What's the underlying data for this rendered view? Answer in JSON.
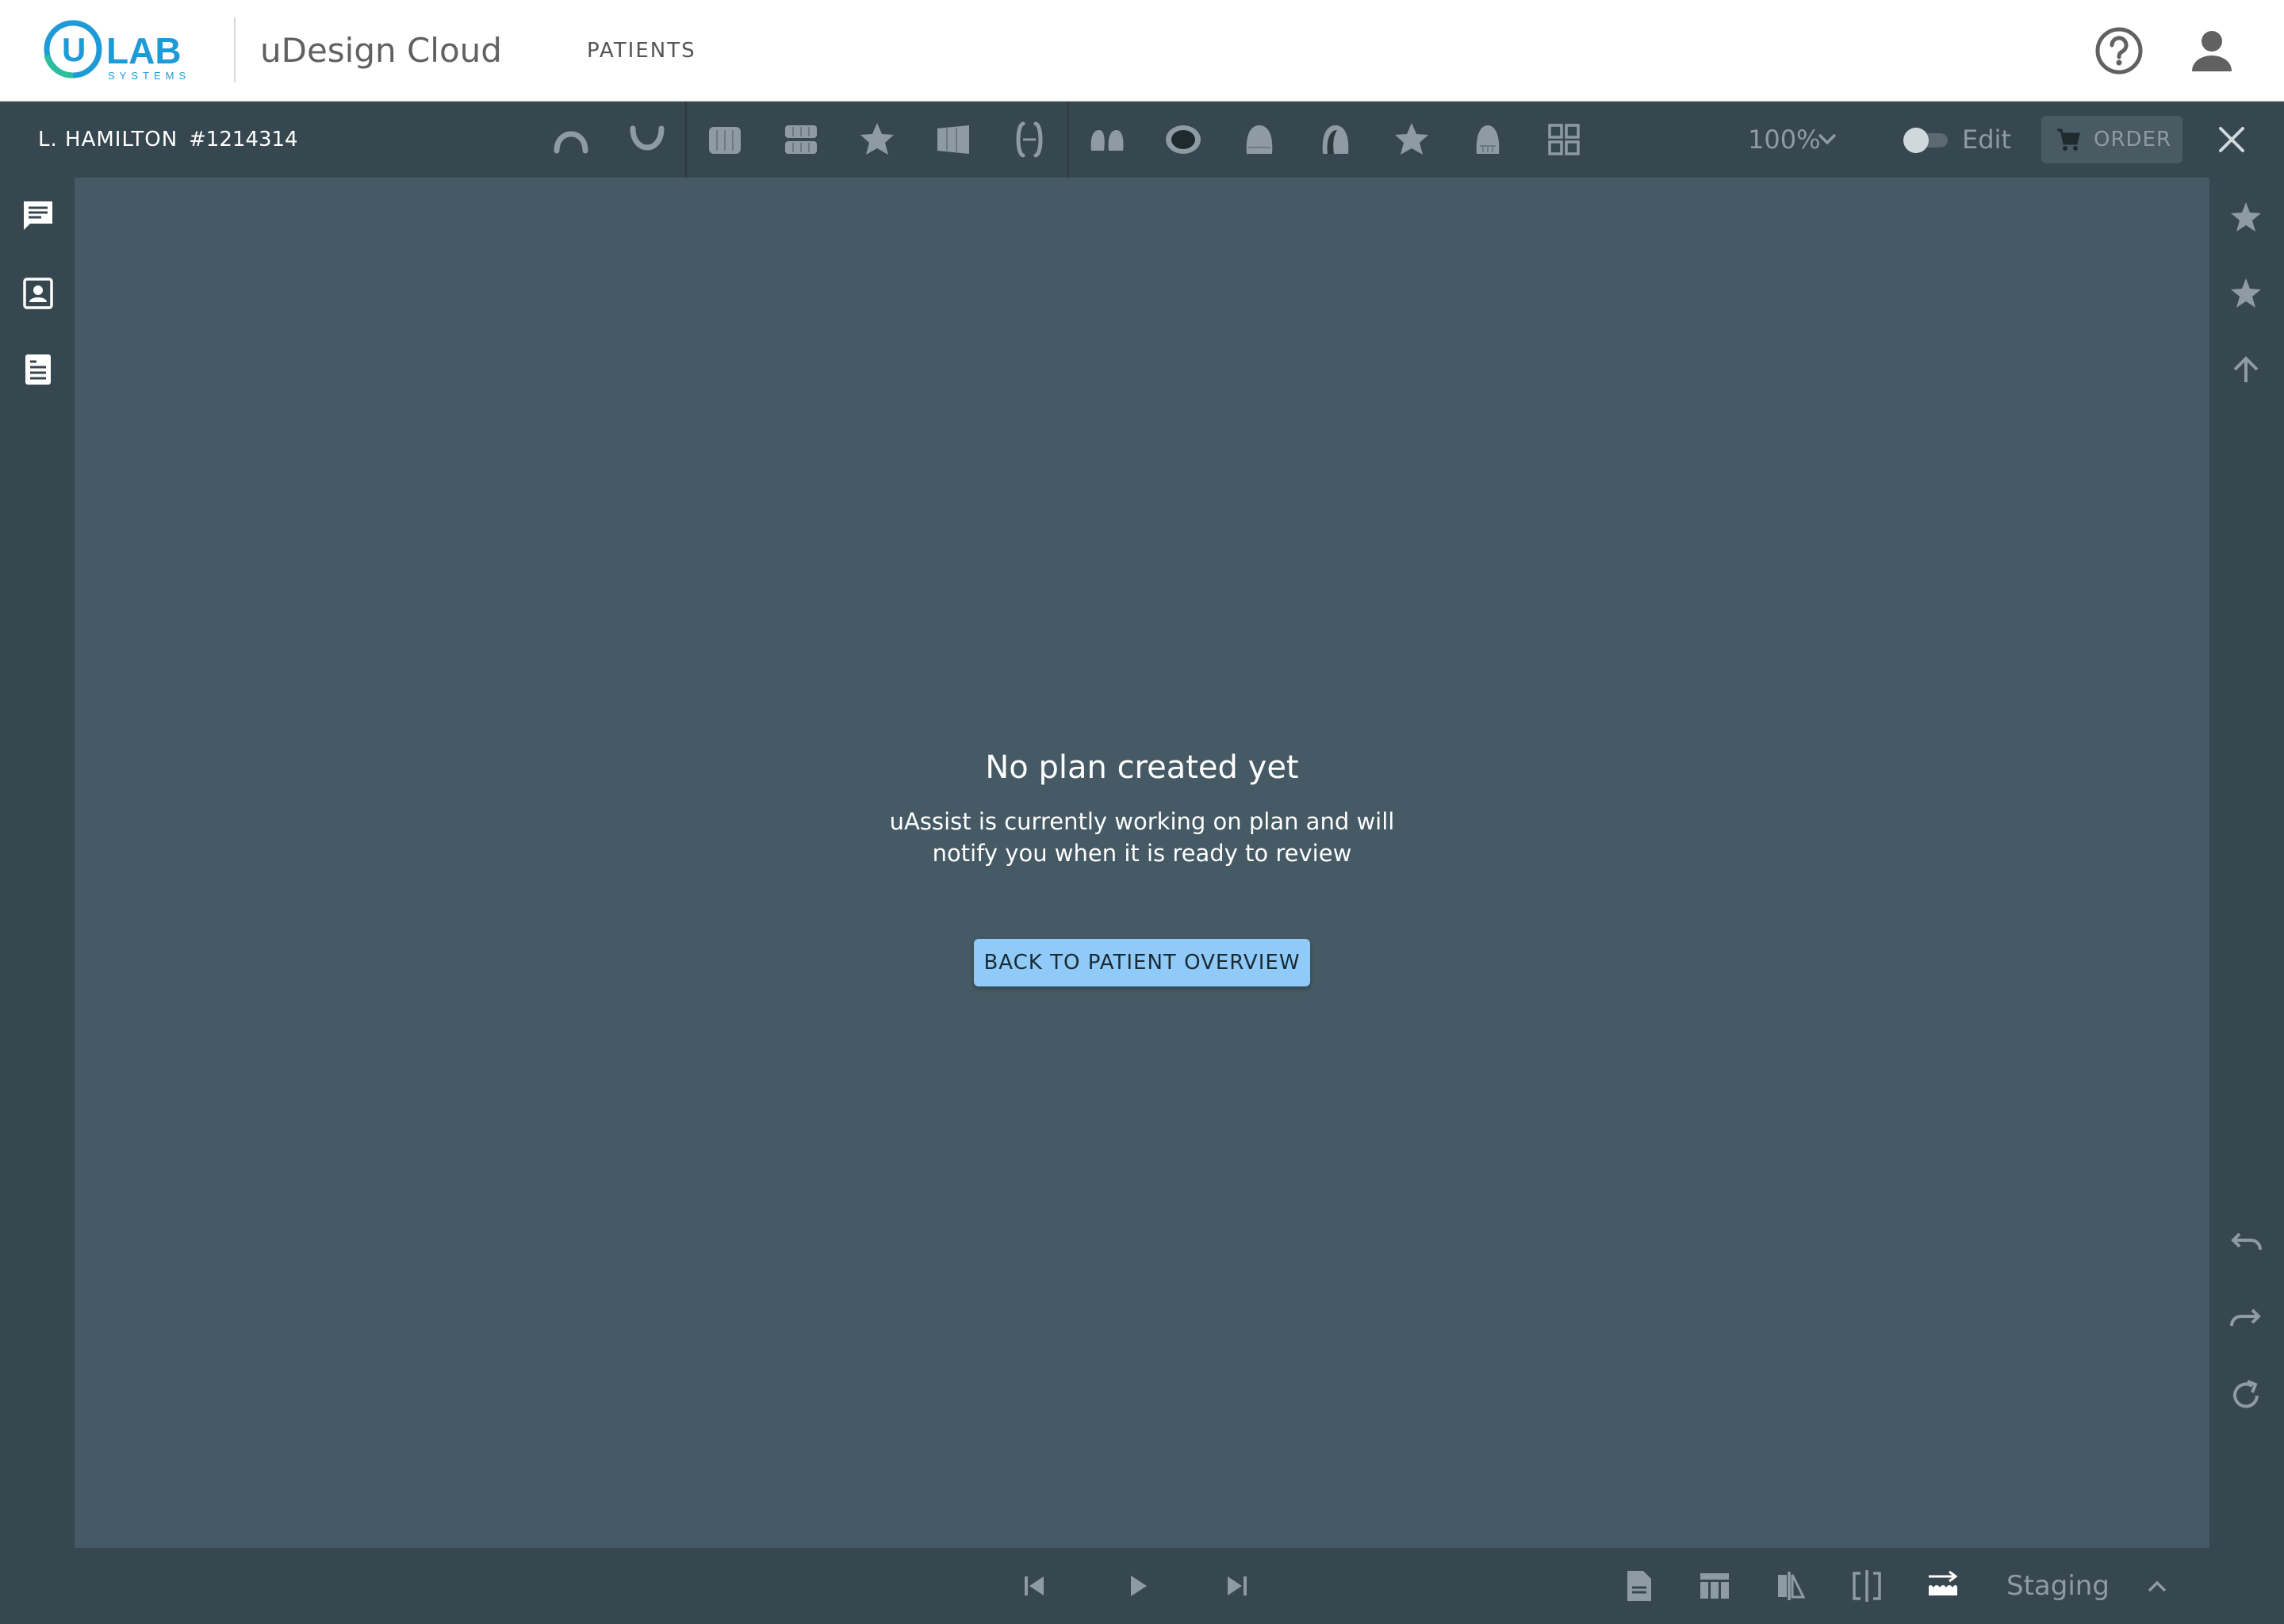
{
  "app": {
    "logo_text": "ULAB",
    "logo_subtext": "SYSTEMS",
    "brand": "uDesign Cloud",
    "nav": {
      "patients": "PATIENTS"
    }
  },
  "toolbar": {
    "patient_name": "L. HAMILTON",
    "patient_id": "#1214314",
    "zoom": "100%",
    "edit_label": "Edit",
    "edit_enabled": false,
    "order_label": "ORDER"
  },
  "canvas": {
    "title": "No plan created yet",
    "message_line1": "uAssist is currently working on plan and will",
    "message_line2": "notify you when it is ready to review",
    "button_label": "BACK TO PATIENT OVERVIEW"
  },
  "bottom": {
    "staging_label": "Staging"
  },
  "colors": {
    "toolbar_bg": "#37474f",
    "canvas_bg": "#455a64",
    "accent_button": "#90caf9",
    "logo_blue": "#1e9ad6",
    "icon_muted": "#8e9ba2"
  },
  "icons": {
    "toolbar": [
      "upper-arch-icon",
      "lower-arch-icon",
      "teeth-front-icon",
      "teeth-both-icon",
      "favorite-star-icon",
      "teeth-side-icon",
      "teeth-split-icon",
      "tooth-pair-icon",
      "tooth-dark-icon",
      "tooth-crown-icon",
      "tooth-shaded-icon",
      "favorite-star-icon-2",
      "tooth-occlusal-icon",
      "grid-view-icon"
    ],
    "left_rail": [
      "chat-icon",
      "patient-card-icon",
      "records-icon"
    ],
    "right_rail": [
      "star-icon",
      "star-icon-2",
      "arrow-up-icon",
      "undo-icon",
      "redo-icon",
      "refresh-icon"
    ],
    "bottom": [
      "skip-previous-icon",
      "play-icon",
      "skip-next-icon",
      "report-icon",
      "table-layout-icon",
      "compare-icon",
      "split-view-icon",
      "staging-teeth-icon"
    ]
  }
}
